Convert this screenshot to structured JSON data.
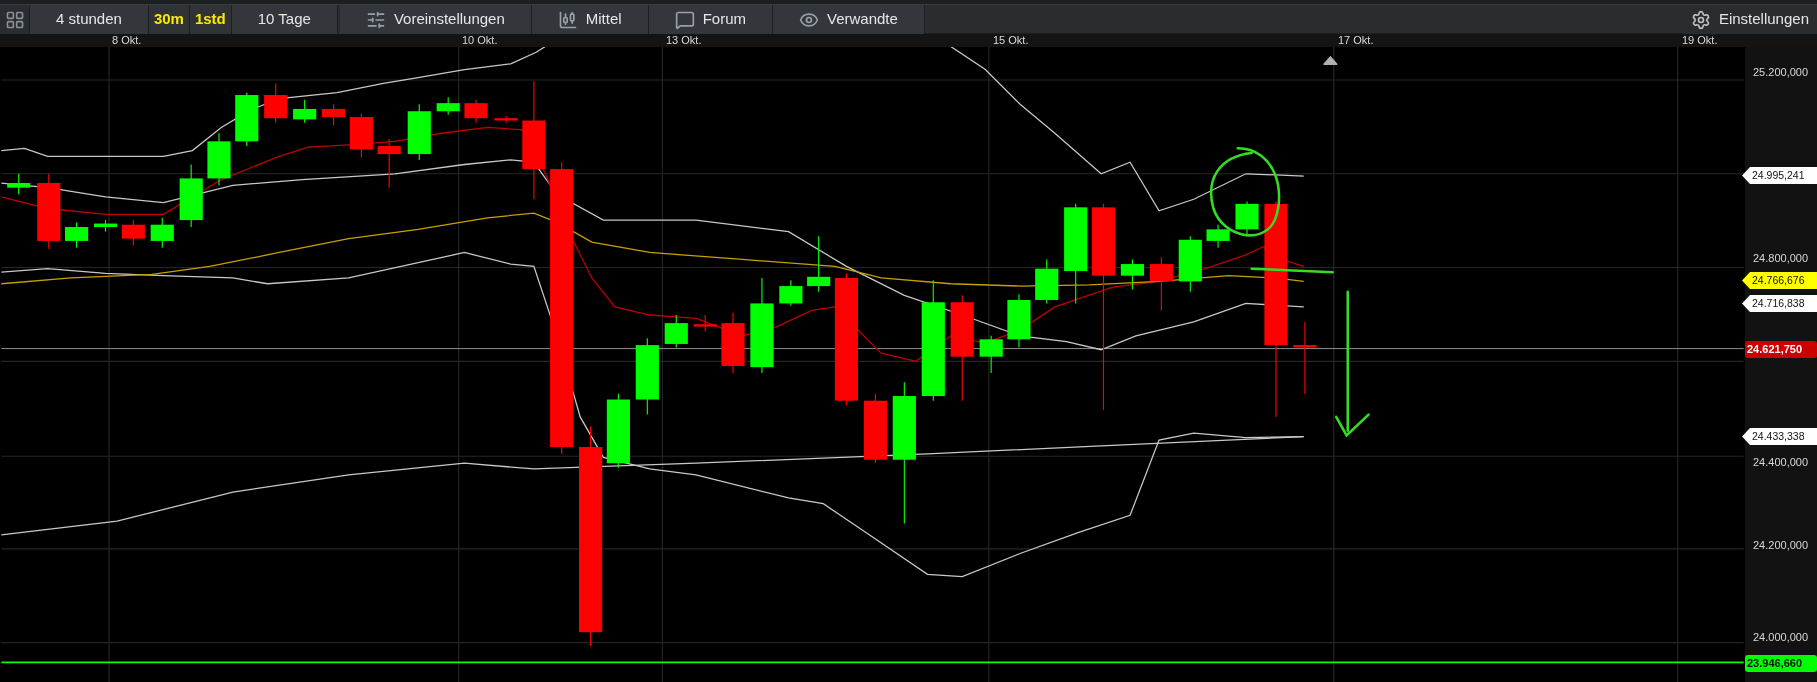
{
  "toolbar": {
    "items": [
      {
        "kind": "button",
        "label": "4 stunden"
      },
      {
        "kind": "shortcut",
        "label": "30m"
      },
      {
        "kind": "shortcut",
        "label": "1std"
      },
      {
        "kind": "button",
        "label": "10 Tage"
      },
      {
        "kind": "presets",
        "label": "Voreinstellungen"
      },
      {
        "kind": "candles",
        "label": "Mittel"
      },
      {
        "kind": "forum",
        "label": "Forum"
      },
      {
        "kind": "related",
        "label": "Verwandte"
      }
    ],
    "settings": {
      "label": "Einstellungen"
    }
  },
  "date_axis": [
    "8 Okt.",
    "10 Okt.",
    "13 Okt.",
    "15 Okt.",
    "17 Okt.",
    "19 Okt."
  ],
  "price_axis": [
    "25.200,000",
    "24.800,000",
    "24.400,000",
    "24.200,000",
    "24.000,000"
  ],
  "price_tags": [
    {
      "kind": "pointer",
      "label": "24.995,241",
      "color": "#ffffff"
    },
    {
      "kind": "pointer",
      "label": "24.766,676",
      "color": "#ffff00"
    },
    {
      "kind": "pointer",
      "label": "24.716,838",
      "color": "#ffffff"
    },
    {
      "kind": "box",
      "label": "24.621,750",
      "color": "#cc0000"
    },
    {
      "kind": "pointer",
      "label": "24.433,338",
      "color": "#ffffff"
    },
    {
      "kind": "box",
      "label": "23.946,660",
      "color": "#00ff00"
    }
  ]
}
